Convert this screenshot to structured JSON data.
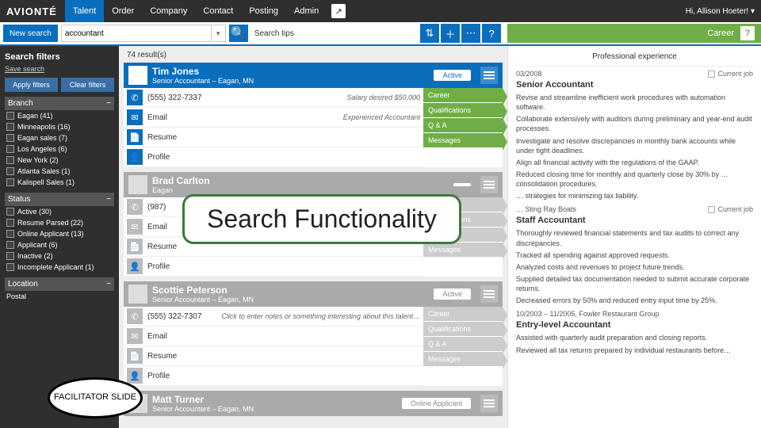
{
  "top": {
    "brand": "AVIONTÉ",
    "nav": [
      "Talent",
      "Order",
      "Company",
      "Contact",
      "Posting",
      "Admin"
    ],
    "greeting": "Hi, Allison Hoeter! ▾"
  },
  "toolbar": {
    "new_search": "New search",
    "query": "accountant",
    "tips": "Search tips",
    "career_label": "Career"
  },
  "sidebar": {
    "title": "Search filters",
    "save": "Save search",
    "apply": "Apply filters",
    "clear": "Clear filters",
    "group_branch": "Branch",
    "branch": [
      "Eagan (41)",
      "Minneapolis (16)",
      "Eagan sales (7)",
      "Los Angeles (6)",
      "New York (2)",
      "Atlanta Sales (1)",
      "Kalispell Sales (1)"
    ],
    "group_status": "Status",
    "status": [
      "Active (30)",
      "Resume Parsed (22)",
      "Online Applicant (13)",
      "Applicant (6)",
      "Inactive (2)",
      "Incomplete Applicant (1)"
    ],
    "group_location": "Location",
    "loc_label": "Postal"
  },
  "results": {
    "count": "74 result(s)",
    "tags": [
      "Career",
      "Qualifications",
      "Q & A",
      "Messages"
    ],
    "cards": [
      {
        "name": "Tim Jones",
        "sub": "Senior Accountant – Eagan, MN",
        "status": "Active",
        "phone": "(555) 322-7337",
        "salary": "Salary desired $50,000",
        "note": "Experienced Accountant",
        "email": "Email",
        "resume": "Resume",
        "profile": "Profile"
      },
      {
        "name": "Brad Carlton",
        "sub": "Eagan",
        "status": "",
        "phone": "(987)",
        "salary": "",
        "note": "",
        "email": "Email",
        "resume": "Resume",
        "profile": "Profile"
      },
      {
        "name": "Scottie Peterson",
        "sub": "Senior Accountant – Eagan, MN",
        "status": "Active",
        "phone": "(555) 322-7307",
        "salary": "",
        "note": "Click to enter notes or something interesting about this talent…",
        "email": "Email",
        "resume": "Resume",
        "profile": "Profile"
      },
      {
        "name": "Matt Turner",
        "sub": "Senior Accountant – Eagan, MN",
        "status": "Online Applicant",
        "phone": "",
        "salary": "",
        "note": "",
        "email": "",
        "resume": "",
        "profile": ""
      }
    ]
  },
  "detail": {
    "header": "Professional experience",
    "blocks": [
      {
        "date": "03/2008",
        "current": "Current job",
        "title": "Senior Accountant",
        "paras": [
          "Revise and streamline inefficient work procedures with automation software.",
          "Collaborate extensively with auditors during preliminary and year-end audit processes.",
          "Investigate and resolve discrepancies in monthly bank accounts while under tight deadlines.",
          "Align all financial activity with the regulations of the GAAP.",
          "Reduced closing time for monthly and quarterly close by 30% by … consolidation procedures.",
          "… strategies for minimizing tax liability."
        ]
      },
      {
        "date": "… Sting Ray Boats",
        "current": "Current job",
        "title": "Staff Accountant",
        "paras": [
          "Thoroughly reviewed financial statements and tax audits to correct any discrepancies.",
          "Tracked all spending against approved requests.",
          "Analyzed costs and revenues to project future trends.",
          "Supplied detailed tax documentation needed to submit accurate corporate returns.",
          "Decreased errors by 50% and reduced entry input time by 25%."
        ]
      },
      {
        "date": "10/2003 – 11/2005, Fowler Restaurant Group",
        "current": "",
        "title": "Entry-level Accountant",
        "paras": [
          "Assisted with quarterly audit preparation and closing reports.",
          "Reviewed all tax returns prepared by individual restaurants before…"
        ]
      }
    ]
  },
  "overlay": "Search Functionality",
  "facilitator": "FACILITATOR SLIDE"
}
